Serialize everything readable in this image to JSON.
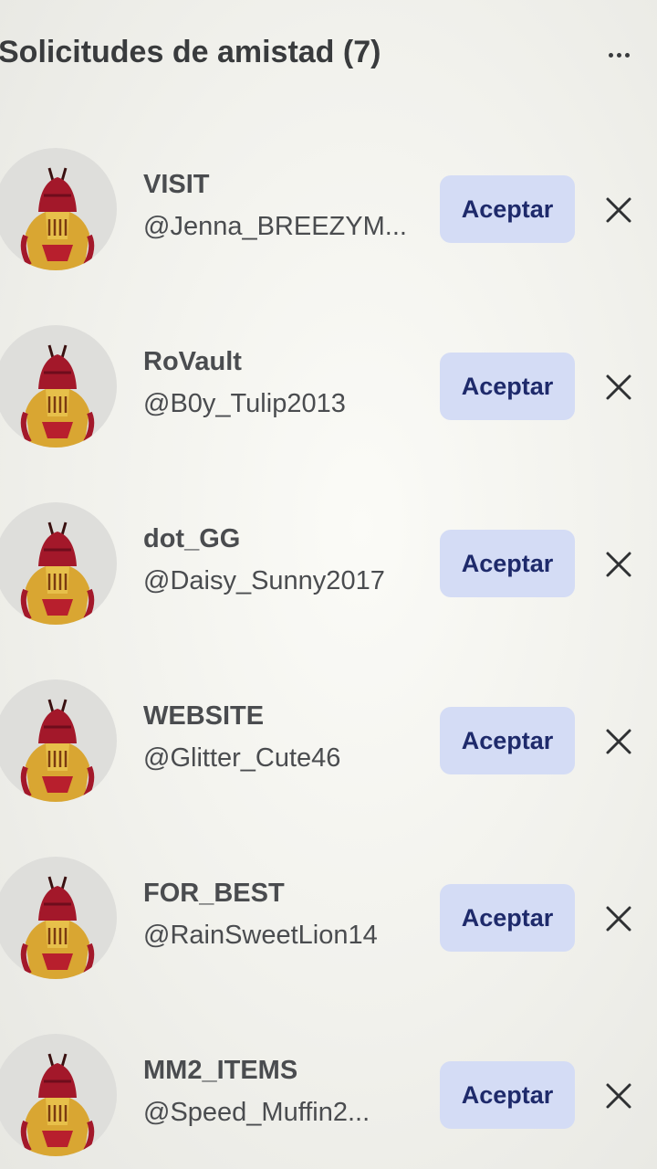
{
  "header": {
    "title": "Solicitudes de amistad (7)",
    "more_icon": "more-horizontal-icon"
  },
  "requests": [
    {
      "name": "VISIT",
      "handle": "@Jenna_BREEZYM...",
      "accept_label": "Aceptar"
    },
    {
      "name": "RoVault",
      "handle": "@B0y_Tulip2013",
      "accept_label": "Aceptar"
    },
    {
      "name": "dot_GG",
      "handle": "@Daisy_Sunny2017",
      "accept_label": "Aceptar"
    },
    {
      "name": "WEBSITE",
      "handle": "@Glitter_Cute46",
      "accept_label": "Aceptar"
    },
    {
      "name": "FOR_BEST",
      "handle": "@RainSweetLion14",
      "accept_label": "Aceptar"
    },
    {
      "name": "MM2_ITEMS",
      "handle": "@Speed_Muffin2...",
      "accept_label": "Aceptar"
    }
  ],
  "icons": {
    "decline": "close-icon",
    "avatar": "avatar-knight-icon"
  },
  "colors": {
    "accent_button_bg": "#d4dcf5",
    "accent_button_text": "#1e2a6b",
    "text": "#393b3d"
  }
}
